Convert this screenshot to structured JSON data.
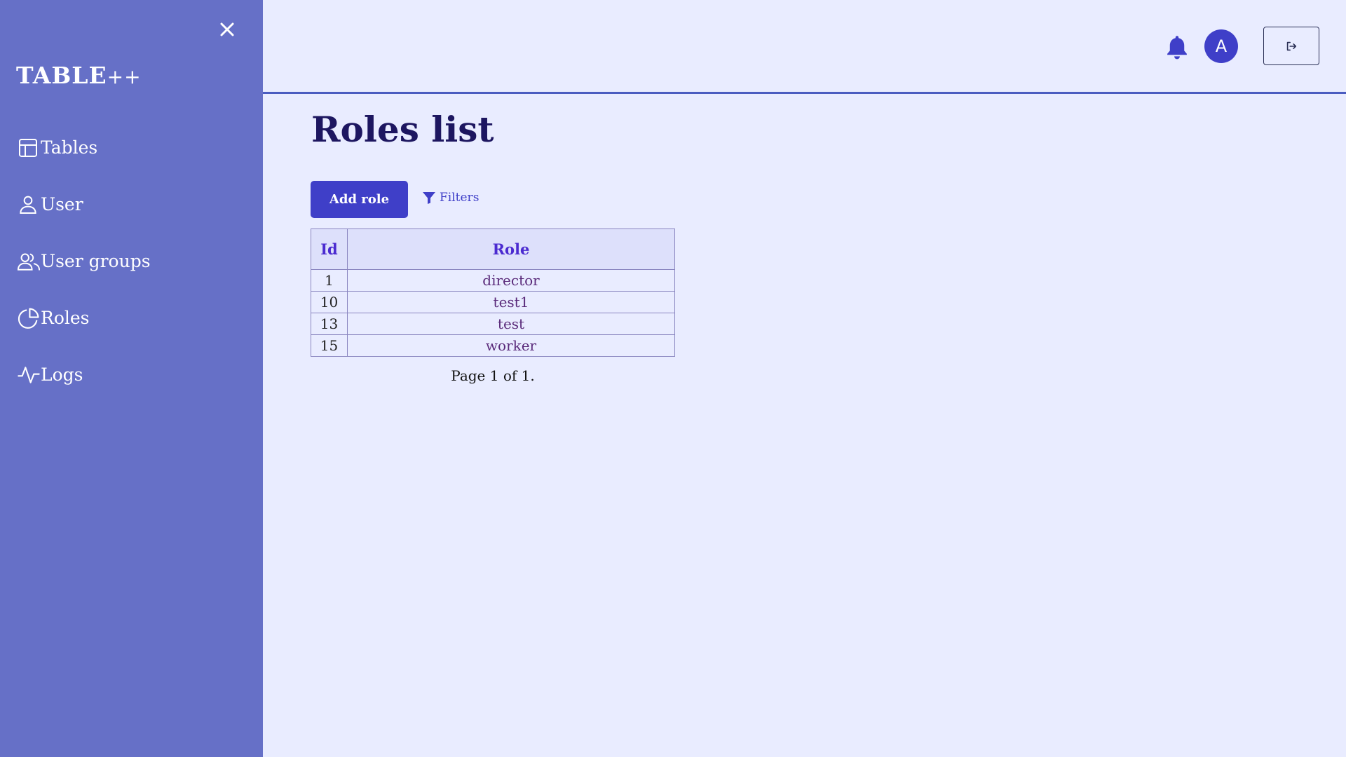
{
  "app": {
    "brand_main": "TABLE",
    "brand_suffix": "++"
  },
  "sidebar": {
    "items": [
      {
        "label": "Tables",
        "icon": "table-icon"
      },
      {
        "label": "User",
        "icon": "user-icon"
      },
      {
        "label": "User groups",
        "icon": "users-icon"
      },
      {
        "label": "Roles",
        "icon": "pie-chart-icon"
      },
      {
        "label": "Logs",
        "icon": "activity-icon"
      }
    ]
  },
  "header": {
    "avatar_initial": "A"
  },
  "main": {
    "title": "Roles list",
    "add_button_label": "Add role",
    "filters_label": "Filters",
    "table": {
      "columns": [
        "Id",
        "Role"
      ],
      "rows": [
        {
          "id": "1",
          "role": "director"
        },
        {
          "id": "10",
          "role": "test1"
        },
        {
          "id": "13",
          "role": "test"
        },
        {
          "id": "15",
          "role": "worker"
        }
      ]
    },
    "pagination_text": "Page 1 of 1."
  },
  "colors": {
    "sidebar_bg": "#6670c7",
    "page_bg": "#e9ecff",
    "accent": "#3f3fc8",
    "title": "#1d1660"
  }
}
